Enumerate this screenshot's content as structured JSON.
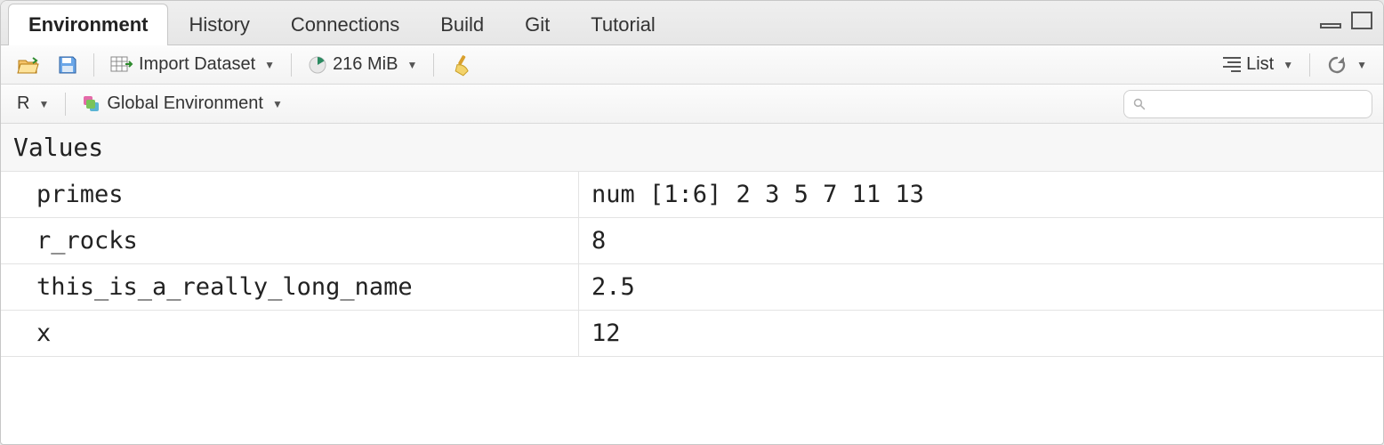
{
  "tabs": [
    {
      "label": "Environment",
      "active": true
    },
    {
      "label": "History",
      "active": false
    },
    {
      "label": "Connections",
      "active": false
    },
    {
      "label": "Build",
      "active": false
    },
    {
      "label": "Git",
      "active": false
    },
    {
      "label": "Tutorial",
      "active": false
    }
  ],
  "toolbar": {
    "import_dataset": "Import Dataset",
    "memory": "216 MiB",
    "view_mode": "List"
  },
  "scope": {
    "engine": "R",
    "environment": "Global Environment"
  },
  "search": {
    "placeholder": ""
  },
  "section_label": "Values",
  "variables": [
    {
      "name": "primes",
      "value": "num [1:6] 2 3 5 7 11 13"
    },
    {
      "name": "r_rocks",
      "value": "8"
    },
    {
      "name": "this_is_a_really_long_name",
      "value": "2.5"
    },
    {
      "name": "x",
      "value": "12"
    }
  ]
}
